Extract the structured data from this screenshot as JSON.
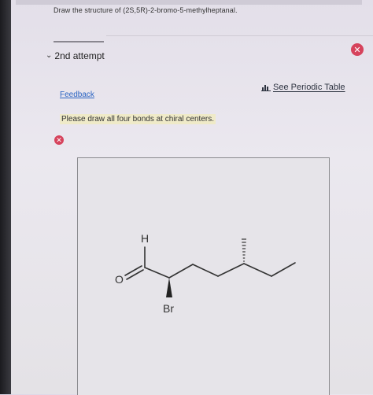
{
  "question": {
    "text": "Draw the structure of (2S,5R)-2-bromo-5-methylheptanal."
  },
  "attempt": {
    "label": "2nd attempt"
  },
  "feedback": {
    "link_label": "Feedback",
    "instruction": "Please draw all four bonds at chiral centers."
  },
  "periodic_table": {
    "label": "See Periodic Table"
  },
  "molecule": {
    "atoms": {
      "oxygen": "O",
      "hydrogen": "H",
      "bromine": "Br"
    }
  },
  "colors": {
    "error": "#d6435c",
    "link": "#2a63c2",
    "highlight": "#efeac8"
  },
  "icons": {
    "close": "close-icon",
    "error": "error-icon",
    "chevron": "chevron-down-icon",
    "periodic": "bar-chart-icon"
  }
}
